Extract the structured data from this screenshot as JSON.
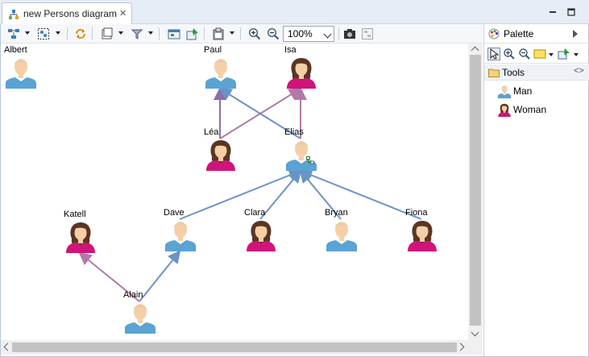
{
  "editor": {
    "tab_title": "new Persons diagram",
    "zoom_value": "100%"
  },
  "toolbar": {
    "icons": [
      "arrange-icon",
      "select-all-icon",
      "refresh-icon",
      "layer-icon",
      "filter-icon",
      "export-icon",
      "pin-icon",
      "paste-format-icon",
      "zoom-in-icon",
      "zoom-out-icon",
      "camera-icon",
      "outline-icon"
    ]
  },
  "palette": {
    "title": "Palette",
    "drawer_title": "Tools",
    "items": [
      {
        "label": "Man",
        "kind": "man"
      },
      {
        "label": "Woman",
        "kind": "woman"
      }
    ]
  },
  "diagram": {
    "nodes": [
      {
        "id": "albert",
        "label": "Albert",
        "kind": "man"
      },
      {
        "id": "paul",
        "label": "Paul",
        "kind": "man"
      },
      {
        "id": "isa",
        "label": "Isa",
        "kind": "woman"
      },
      {
        "id": "lea",
        "label": "Léa",
        "kind": "woman"
      },
      {
        "id": "elias",
        "label": "Elias",
        "kind": "man"
      },
      {
        "id": "katell",
        "label": "Katell",
        "kind": "woman"
      },
      {
        "id": "dave",
        "label": "Dave",
        "kind": "man"
      },
      {
        "id": "clara",
        "label": "Clara",
        "kind": "woman"
      },
      {
        "id": "bryan",
        "label": "Bryan",
        "kind": "man"
      },
      {
        "id": "fiona",
        "label": "Fiona",
        "kind": "woman"
      },
      {
        "id": "alain",
        "label": "Alain",
        "kind": "man"
      }
    ],
    "edges": [
      {
        "from": "lea",
        "to": "paul",
        "color": "#8e6ea8"
      },
      {
        "from": "lea",
        "to": "isa",
        "color": "#b07aa8"
      },
      {
        "from": "elias",
        "to": "paul",
        "color": "#6a93c6"
      },
      {
        "from": "elias",
        "to": "isa",
        "color": "#b07aa8"
      },
      {
        "from": "dave",
        "to": "elias",
        "color": "#6a93c6"
      },
      {
        "from": "clara",
        "to": "elias",
        "color": "#6a93c6"
      },
      {
        "from": "bryan",
        "to": "elias",
        "color": "#6a93c6"
      },
      {
        "from": "fiona",
        "to": "elias",
        "color": "#6a93c6"
      },
      {
        "from": "alain",
        "to": "katell",
        "color": "#b07aa8"
      },
      {
        "from": "alain",
        "to": "dave",
        "color": "#6a93c6"
      }
    ]
  },
  "colors": {
    "man_shirt": "#5aa3d3",
    "woman_shirt": "#d0147a",
    "skin": "#f5cfa8",
    "hair_man": "#e8c9a8",
    "hair_woman": "#5a3620"
  }
}
